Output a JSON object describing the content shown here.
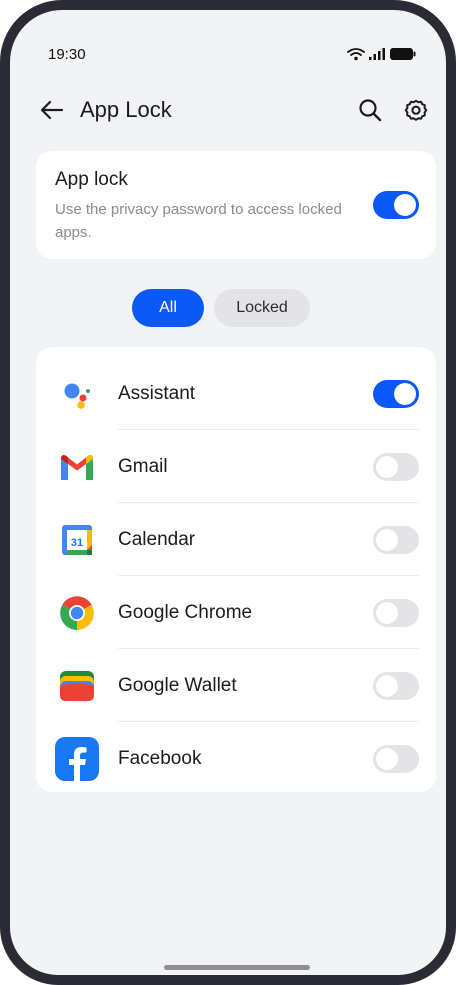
{
  "status_bar": {
    "time": "19:30",
    "icons": [
      "wifi-icon",
      "signal-icon",
      "battery-icon"
    ]
  },
  "app_bar": {
    "title": "App Lock",
    "back_icon": "arrow-left-icon",
    "search_icon": "search-icon",
    "settings_icon": "gear-icon"
  },
  "app_lock_card": {
    "title": "App lock",
    "description": "Use the privacy password to access locked apps.",
    "enabled": true
  },
  "filters": [
    {
      "label": "All",
      "active": true
    },
    {
      "label": "Locked",
      "active": false
    }
  ],
  "apps": [
    {
      "name": "Assistant",
      "icon": "google-assistant-icon",
      "locked": true
    },
    {
      "name": "Gmail",
      "icon": "gmail-icon",
      "locked": false
    },
    {
      "name": "Calendar",
      "icon": "google-calendar-icon",
      "locked": false,
      "icon_text": "31"
    },
    {
      "name": "Google Chrome",
      "icon": "chrome-icon",
      "locked": false
    },
    {
      "name": "Google Wallet",
      "icon": "google-wallet-icon",
      "locked": false
    },
    {
      "name": "Facebook",
      "icon": "facebook-icon",
      "locked": false
    }
  ],
  "colors": {
    "accent": "#0a59f7",
    "background": "#f2f3f5",
    "card": "#ffffff",
    "toggle_off": "#e4e4e6",
    "secondary_text": "#8a8a90"
  }
}
